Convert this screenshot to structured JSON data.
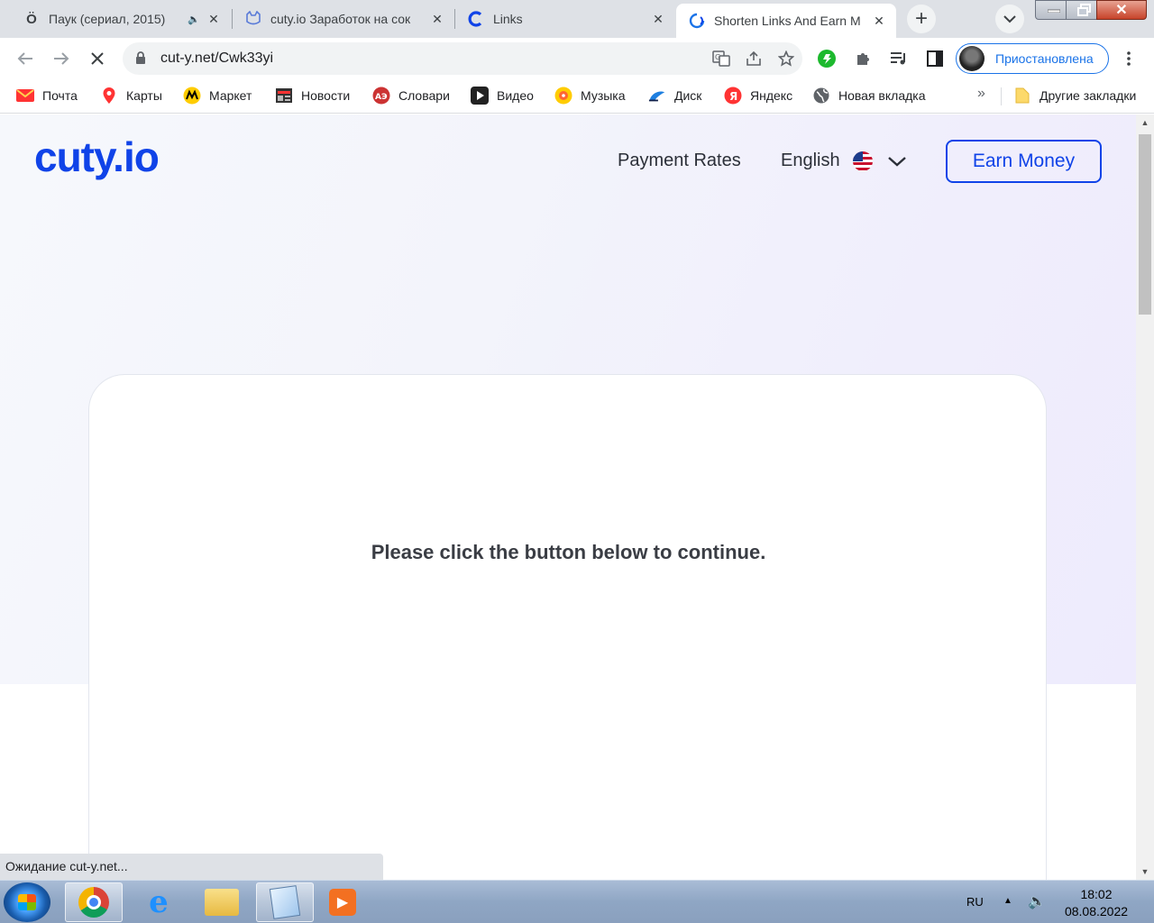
{
  "browser": {
    "tabs": [
      {
        "title": "Паук (сериал, 2015)",
        "favicon": "Ö",
        "muted_indicator": "🔈"
      },
      {
        "title": "cuty.io Заработок на сок",
        "favicon": "cat-icon"
      },
      {
        "title": "Links",
        "favicon": "C"
      },
      {
        "title": "Shorten Links And Earn M",
        "favicon": "loading-icon",
        "active": true
      }
    ],
    "url": "cut-y.net/Cwk33yi",
    "profile_label": "Приостановлена",
    "bookmarks": [
      {
        "label": "Почта",
        "icon": "mail-icon"
      },
      {
        "label": "Карты",
        "icon": "map-pin-icon"
      },
      {
        "label": "Маркет",
        "icon": "market-icon"
      },
      {
        "label": "Новости",
        "icon": "news-icon"
      },
      {
        "label": "Словари",
        "icon": "dictionary-icon"
      },
      {
        "label": "Видео",
        "icon": "video-icon"
      },
      {
        "label": "Музыка",
        "icon": "music-icon"
      },
      {
        "label": "Диск",
        "icon": "disk-icon"
      },
      {
        "label": "Яндекс",
        "icon": "yandex-icon"
      },
      {
        "label": "Новая вкладка",
        "icon": "globe-icon"
      }
    ],
    "more_bookmarks": "»",
    "other_bookmarks": "Другие закладки",
    "status_text": "Ожидание cut-y.net..."
  },
  "page": {
    "logo": "cuty.io",
    "nav": {
      "payment_rates": "Payment Rates",
      "language": "English",
      "earn_money": "Earn Money"
    },
    "card_message": "Please click the button below to continue."
  },
  "taskbar": {
    "lang": "RU",
    "time": "18:02",
    "date": "08.08.2022"
  },
  "colors": {
    "brand": "#1043e8",
    "tab_strip": "#dee1e6",
    "profile_accent": "#1a73e8"
  }
}
